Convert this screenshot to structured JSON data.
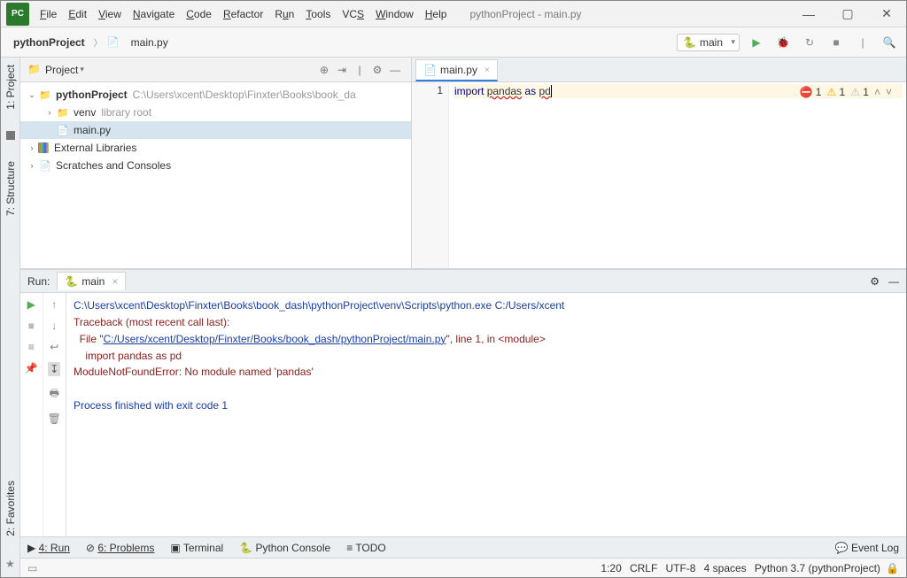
{
  "window": {
    "title": "pythonProject - main.py"
  },
  "menu": {
    "file": "File",
    "edit": "Edit",
    "view": "View",
    "navigate": "Navigate",
    "code": "Code",
    "refactor": "Refactor",
    "run": "Run",
    "tools": "Tools",
    "vcs": "VCS",
    "window": "Window",
    "help": "Help"
  },
  "breadcrumb": {
    "project": "pythonProject",
    "file": "main.py"
  },
  "run_config": {
    "name": "main"
  },
  "project_pane": {
    "title": "Project",
    "root": "pythonProject",
    "root_path": "C:\\Users\\xcent\\Desktop\\Finxter\\Books\\book_da",
    "venv": "venv",
    "venv_hint": "library root",
    "mainpy": "main.py",
    "ext_libs": "External Libraries",
    "scratches": "Scratches and Consoles"
  },
  "editor": {
    "tab": "main.py",
    "line_no": "1",
    "code": {
      "kw1": "import",
      "mod": "pandas",
      "kw2": "as",
      "alias": "pd"
    },
    "inspect": {
      "errors": "1",
      "warnings": "1",
      "weak": "1"
    }
  },
  "run": {
    "title": "Run:",
    "tab": "main",
    "lines": {
      "cmd": "C:\\Users\\xcent\\Desktop\\Finxter\\Books\\book_dash\\pythonProject\\venv\\Scripts\\python.exe C:/Users/xcent",
      "tb": "Traceback (most recent call last):",
      "file_pre": "  File \"",
      "file_link": "C:/Users/xcent/Desktop/Finxter/Books/book_dash/pythonProject/main.py",
      "file_post": "\", line 1, in <module>",
      "imp": "    import pandas as pd",
      "err": "ModuleNotFoundError: No module named 'pandas'",
      "exit": "Process finished with exit code 1"
    }
  },
  "footer": {
    "run": "4: Run",
    "problems": "6: Problems",
    "terminal": "Terminal",
    "pyconsole": "Python Console",
    "todo": "TODO",
    "eventlog": "Event Log"
  },
  "status": {
    "pos": "1:20",
    "le": "CRLF",
    "enc": "UTF-8",
    "indent": "4 spaces",
    "interp": "Python 3.7 (pythonProject)"
  },
  "side_tabs": {
    "project": "1: Project",
    "structure": "7: Structure",
    "favorites": "2: Favorites"
  }
}
